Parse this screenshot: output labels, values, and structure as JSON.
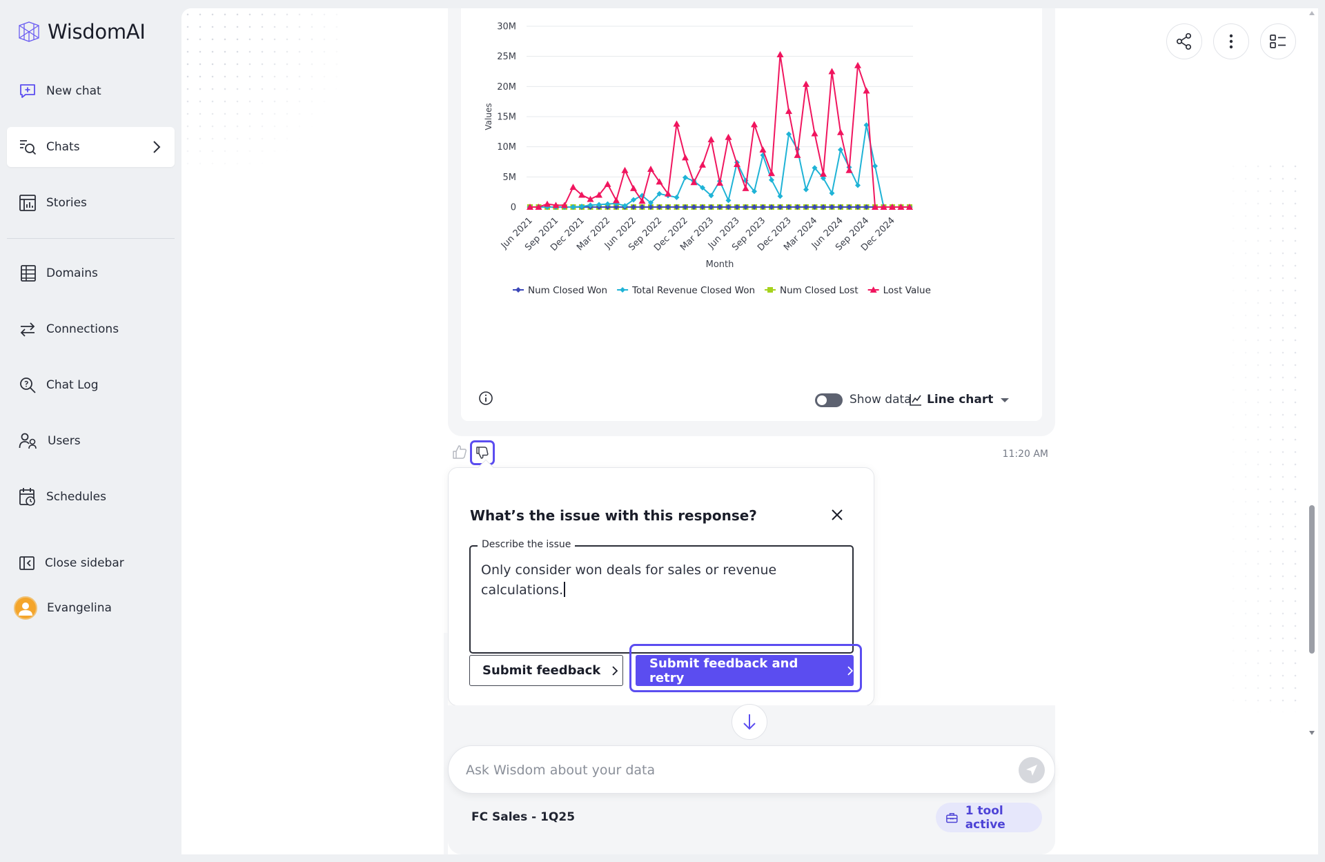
{
  "app": {
    "name": "WisdomAI"
  },
  "sidebar": {
    "items": [
      {
        "label": "New chat"
      },
      {
        "label": "Chats"
      },
      {
        "label": "Stories"
      },
      {
        "label": "Domains"
      },
      {
        "label": "Connections"
      },
      {
        "label": "Chat Log"
      },
      {
        "label": "Users"
      },
      {
        "label": "Schedules"
      }
    ],
    "close_label": "Close sidebar",
    "user_name": "Evangelina"
  },
  "chart_footer": {
    "show_data_label": "Show data",
    "chart_type_label": "Line chart"
  },
  "message": {
    "time": "11:20 AM"
  },
  "feedback_popup": {
    "title": "What’s the issue with this response?",
    "field_label": "Describe the issue",
    "field_value": "Only consider won deals for sales or revenue calculations.",
    "submit_label": "Submit feedback",
    "submit_retry_label": "Submit feedback and retry"
  },
  "composer": {
    "placeholder": "Ask Wisdom about your data",
    "domain": "FC Sales - 1Q25",
    "tools_label": "1 tool active"
  },
  "colors": {
    "accent": "#5b4df0",
    "series_num_closed_won": "#3b47b8",
    "series_total_revenue": "#1fb3d6",
    "series_num_closed_lost": "#a6d21c",
    "series_lost_value": "#f0155e"
  },
  "chart_data": {
    "type": "line",
    "title": "",
    "xlabel": "Month",
    "ylabel": "Values",
    "ylim": [
      0,
      30000000
    ],
    "y_ticks": [
      "0",
      "5M",
      "10M",
      "15M",
      "20M",
      "25M",
      "30M"
    ],
    "x_tick_labels": [
      "Jun 2021",
      "Sep 2021",
      "Dec 2021",
      "Mar 2022",
      "Jun 2022",
      "Sep 2022",
      "Dec 2022",
      "Mar 2023",
      "Jun 2023",
      "Sep 2023",
      "Dec 2023",
      "Mar 2024",
      "Jun 2024",
      "Sep 2024",
      "Dec 2024"
    ],
    "legend_position": "bottom",
    "grid": true,
    "x": [
      "Jun 2021",
      "Jul 2021",
      "Aug 2021",
      "Sep 2021",
      "Oct 2021",
      "Nov 2021",
      "Dec 2021",
      "Jan 2022",
      "Feb 2022",
      "Mar 2022",
      "Apr 2022",
      "May 2022",
      "Jun 2022",
      "Jul 2022",
      "Aug 2022",
      "Sep 2022",
      "Oct 2022",
      "Nov 2022",
      "Dec 2022",
      "Jan 2023",
      "Feb 2023",
      "Mar 2023",
      "Apr 2023",
      "May 2023",
      "Jun 2023",
      "Jul 2023",
      "Aug 2023",
      "Sep 2023",
      "Oct 2023",
      "Nov 2023",
      "Dec 2023",
      "Jan 2024",
      "Feb 2024",
      "Mar 2024",
      "Apr 2024",
      "May 2024",
      "Jun 2024",
      "Jul 2024",
      "Aug 2024",
      "Sep 2024",
      "Oct 2024",
      "Nov 2024",
      "Dec 2024",
      "Jan 2025",
      "Feb 2025"
    ],
    "series": [
      {
        "name": "Num Closed Won",
        "marker": "diamond",
        "values": [
          0,
          0,
          0,
          0,
          0,
          0,
          0,
          0,
          0,
          0,
          0,
          0,
          0,
          0,
          0,
          0,
          0,
          0,
          0,
          0,
          0,
          0,
          0,
          0,
          0,
          0,
          0,
          0,
          0,
          0,
          0,
          0,
          0,
          0,
          0,
          0,
          0,
          0,
          0,
          0,
          0,
          0,
          0,
          0,
          0
        ]
      },
      {
        "name": "Total Revenue Closed Won",
        "marker": "diamond",
        "values": [
          0,
          0,
          0,
          0,
          0,
          0,
          100000,
          300000,
          400000,
          500000,
          600000,
          200000,
          1200000,
          1900000,
          700000,
          2200000,
          1900000,
          1600000,
          4900000,
          4300000,
          3200000,
          1900000,
          4300000,
          1100000,
          7400000,
          4400000,
          2600000,
          8600000,
          4500000,
          1800000,
          12100000,
          9600000,
          2900000,
          6500000,
          4800000,
          2300000,
          9500000,
          6600000,
          3600000,
          13600000,
          6800000,
          0,
          0,
          0,
          0
        ]
      },
      {
        "name": "Num Closed Lost",
        "marker": "square",
        "values": [
          0,
          0,
          0,
          0,
          0,
          0,
          0,
          0,
          0,
          0,
          0,
          0,
          0,
          0,
          0,
          0,
          0,
          0,
          0,
          0,
          0,
          0,
          0,
          0,
          0,
          0,
          0,
          0,
          0,
          0,
          0,
          0,
          0,
          0,
          0,
          0,
          0,
          0,
          0,
          0,
          0,
          0,
          0,
          0,
          0
        ]
      },
      {
        "name": "Lost Value",
        "marker": "triangle",
        "values": [
          0,
          0,
          500000,
          300000,
          300000,
          3300000,
          2000000,
          1300000,
          2000000,
          3800000,
          1100000,
          6100000,
          3100000,
          1000000,
          6300000,
          4200000,
          2200000,
          13800000,
          8200000,
          4100000,
          7000000,
          11200000,
          4000000,
          11600000,
          7100000,
          3100000,
          13700000,
          9500000,
          5600000,
          25300000,
          15900000,
          8600000,
          20400000,
          12200000,
          5500000,
          22500000,
          12400000,
          6100000,
          23500000,
          19300000,
          0,
          0,
          0,
          0,
          0
        ]
      }
    ]
  }
}
